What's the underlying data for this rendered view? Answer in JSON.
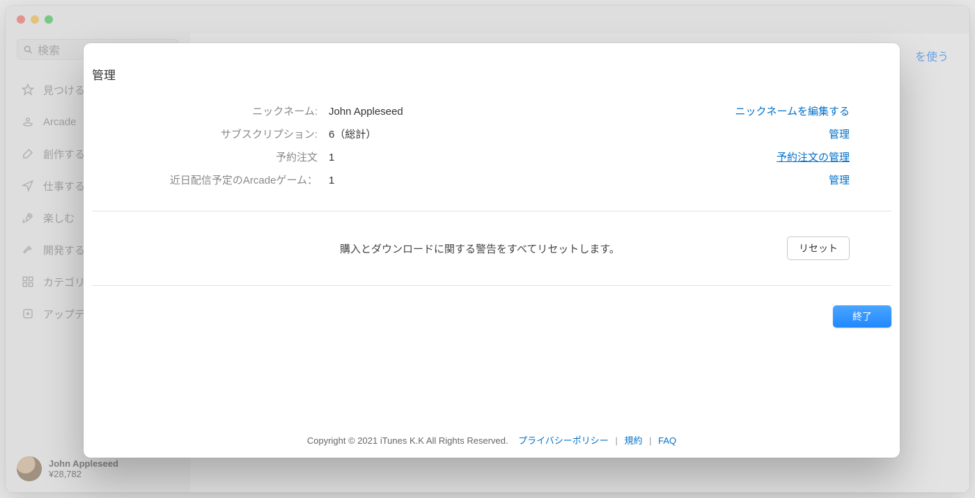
{
  "search": {
    "placeholder": "検索"
  },
  "sidebar": {
    "items": [
      {
        "label": "見つける"
      },
      {
        "label": "Arcade"
      },
      {
        "label": "創作する"
      },
      {
        "label": "仕事する"
      },
      {
        "label": "楽しむ"
      },
      {
        "label": "開発する"
      },
      {
        "label": "カテゴリ"
      },
      {
        "label": "アップデート"
      }
    ]
  },
  "user": {
    "name": "John Appleseed",
    "balance": "¥28,782"
  },
  "topLink": "を使う",
  "modal": {
    "title": "管理",
    "rows": {
      "nickname": {
        "label": "ニックネーム:",
        "value": "John Appleseed",
        "action": "ニックネームを編集する"
      },
      "subscriptions": {
        "label": "サブスクリプション:",
        "value": "6（総計）",
        "action": "管理"
      },
      "preorders": {
        "label": "予約注文",
        "value": "1",
        "action": "予約注文の管理"
      },
      "arcade": {
        "label": "近日配信予定のArcadeゲーム：",
        "value": "1",
        "action": "管理"
      }
    },
    "reset": {
      "text": "購入とダウンロードに関する警告をすべてリセットします。",
      "button": "リセット"
    },
    "done": "終了",
    "footer": {
      "copyright": "Copyright © 2021 iTunes K.K All Rights Reserved.",
      "privacy": "プライバシーポリシー",
      "terms": "規約",
      "faq": "FAQ",
      "sep": "|"
    }
  }
}
